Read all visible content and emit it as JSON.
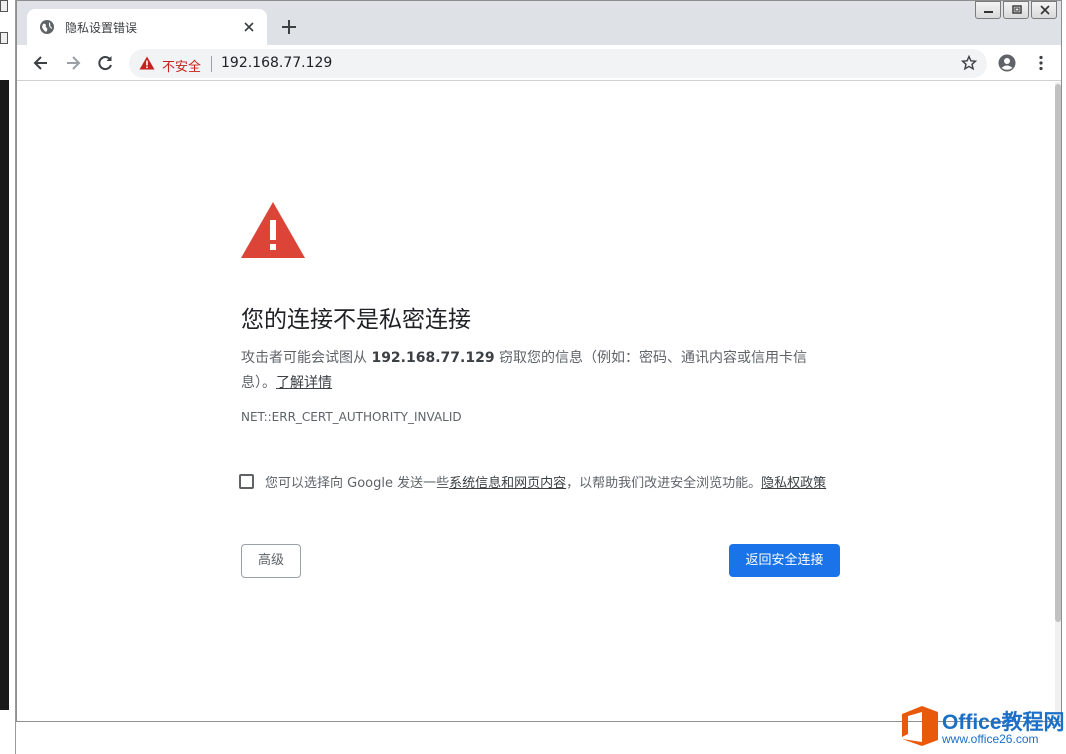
{
  "tab": {
    "title": "隐私设置错误"
  },
  "omnibox": {
    "security_label": "不安全",
    "url": "192.168.77.129"
  },
  "page": {
    "heading": "您的连接不是私密连接",
    "desc_prefix": "攻击者可能会试图从 ",
    "desc_host": "192.168.77.129",
    "desc_suffix": " 窃取您的信息（例如：密码、通讯内容或信用卡信息）。",
    "learn_more": "了解详情",
    "error_code": "NET::ERR_CERT_AUTHORITY_INVALID",
    "optin_prefix": "您可以选择向 Google 发送一些",
    "optin_link": "系统信息和网页内容",
    "optin_middle": "，以帮助我们改进安全浏览功能。",
    "optin_privacy": "隐私权政策",
    "advanced_button": "高级",
    "back_button": "返回安全连接"
  },
  "watermark": {
    "title": "Office教程网",
    "url": "www.office26.com"
  },
  "colors": {
    "accent": "#1a73e8",
    "danger": "#db4437",
    "insecure": "#c5221f"
  },
  "icons": [
    "globe-icon",
    "close-icon",
    "plus-icon",
    "back-arrow-icon",
    "forward-arrow-icon",
    "reload-icon",
    "warning-icon",
    "star-icon",
    "account-icon",
    "kebab-menu-icon",
    "danger-triangle-icon"
  ]
}
